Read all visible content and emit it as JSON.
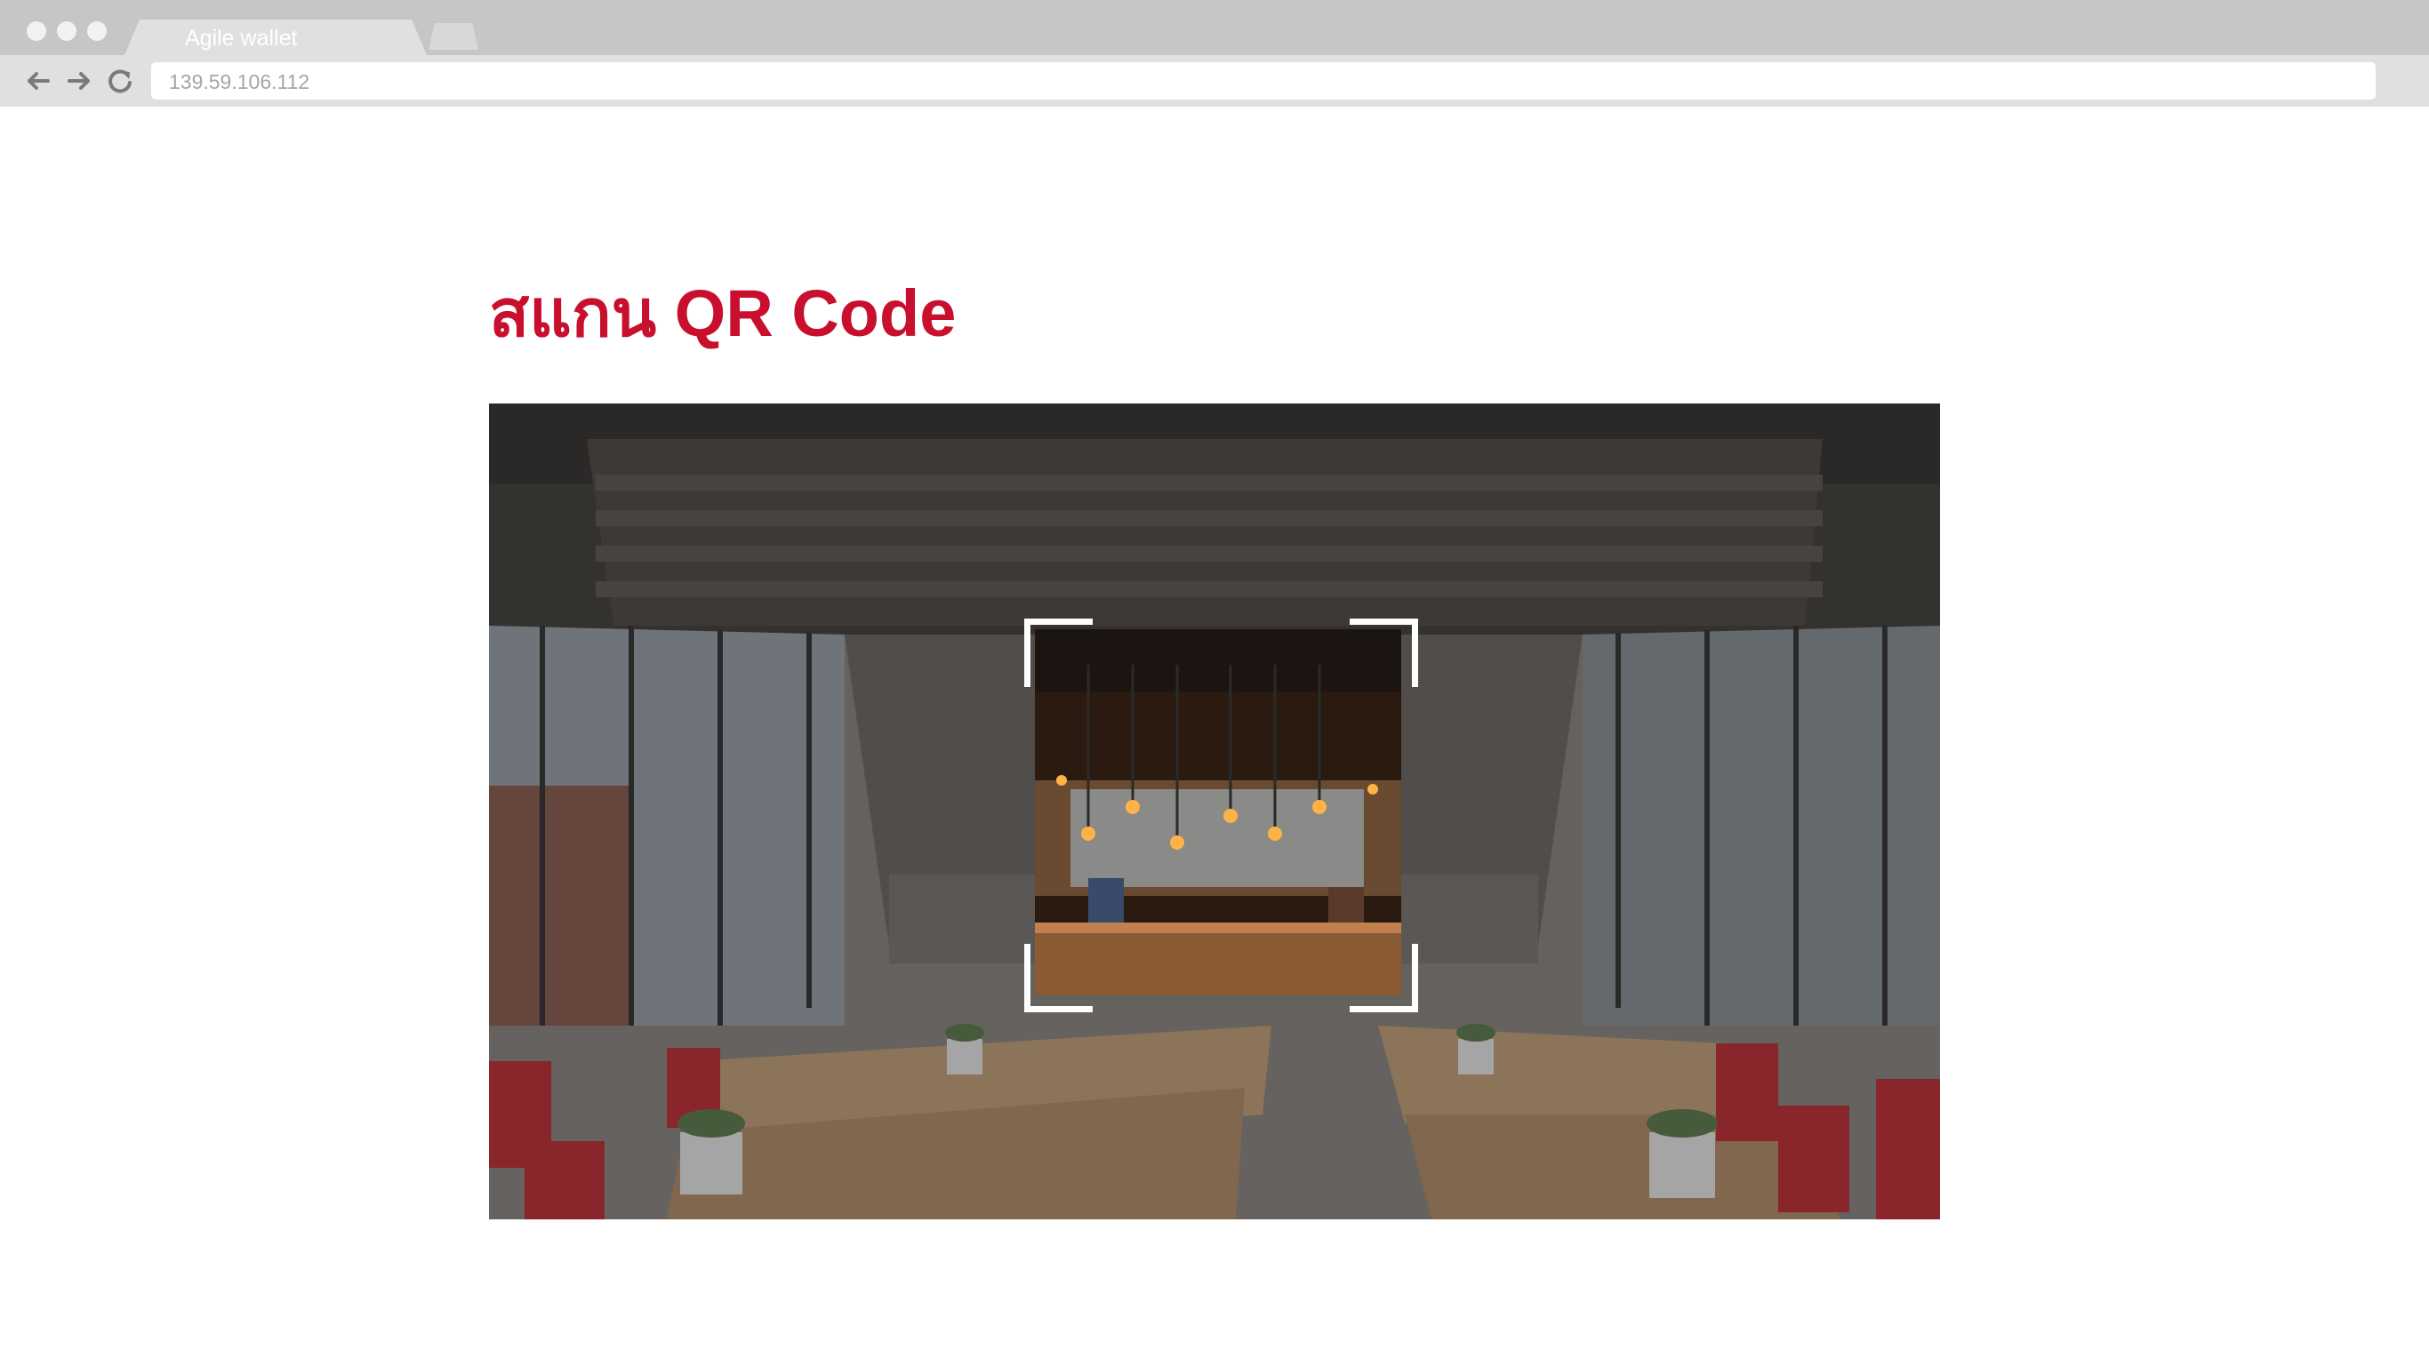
{
  "browser": {
    "tab_title": "Agile wallet",
    "address": "139.59.106.112",
    "icons": {
      "back": "arrow-left-icon",
      "forward": "arrow-right-icon",
      "reload": "reload-icon"
    }
  },
  "page": {
    "title": "สแกน QR Code"
  },
  "scanner": {
    "frame_color": "#ffffff",
    "title_color": "#c8102e"
  }
}
